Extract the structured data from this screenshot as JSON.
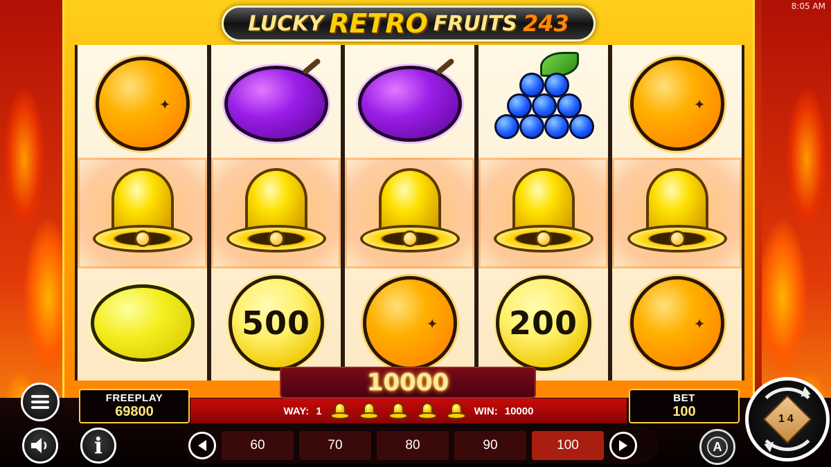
{
  "clock": "8:05 AM",
  "logo": {
    "word1": "LUCKY",
    "word2": "RETRO",
    "word3": "FRUITS",
    "word4": "243"
  },
  "reels": [
    [
      "orange",
      "bell",
      "lemon"
    ],
    [
      "plum",
      "bell",
      "coin"
    ],
    [
      "plum",
      "bell",
      "orange"
    ],
    [
      "grapes",
      "bell",
      "coin"
    ],
    [
      "orange",
      "bell",
      "orange"
    ]
  ],
  "coins": {
    "reel2": "500",
    "reel4": "200"
  },
  "win_total": "10000",
  "info_strip": {
    "way_label": "WAY:",
    "way_value": "1",
    "win_label": "WIN:",
    "win_value": "10000",
    "bell_count": 5
  },
  "freeplay": {
    "label": "FREEPLAY",
    "value": "69800"
  },
  "bet": {
    "label": "BET",
    "value": "100"
  },
  "bet_options": [
    "60",
    "70",
    "80",
    "90",
    "100"
  ],
  "selected_bet": "100",
  "spin_badge": "14",
  "auto_label": "A",
  "info_glyph": "i",
  "colors": {
    "accent": "#ffce3a",
    "strip": "#c80a0a",
    "selected": "#a81e10"
  }
}
